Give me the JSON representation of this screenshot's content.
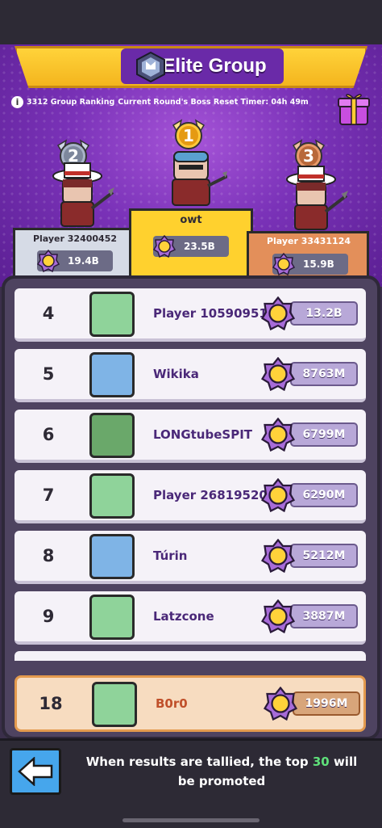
{
  "header": {
    "title": "Elite Group",
    "group_ranking": "3312 Group Ranking",
    "timer_label": "Current Round's Boss Reset Timer: 04h 49m"
  },
  "podium": [
    {
      "rank": "1",
      "name": "owt",
      "score": "23.5B"
    },
    {
      "rank": "2",
      "name": "Player 32400452",
      "score": "19.4B"
    },
    {
      "rank": "3",
      "name": "Player 33431124",
      "score": "15.9B"
    }
  ],
  "list": [
    {
      "rank": "4",
      "name": "Player 10590951",
      "score": "13.2B",
      "avatar": "cat",
      "tag": "S3"
    },
    {
      "rank": "5",
      "name": "Wikika",
      "score": "8763M",
      "avatar": "fish-wizard",
      "tag": ""
    },
    {
      "rank": "6",
      "name": "LONGtubeSPIT",
      "score": "6799M",
      "avatar": "monster",
      "tag": "S2"
    },
    {
      "rank": "7",
      "name": "Player 26819520",
      "score": "6290M",
      "avatar": "ninja",
      "tag": ""
    },
    {
      "rank": "8",
      "name": "Túrin",
      "score": "5212M",
      "avatar": "pirate",
      "tag": "S3"
    },
    {
      "rank": "9",
      "name": "Latzcone",
      "score": "3887M",
      "avatar": "pirate-green",
      "tag": ""
    }
  ],
  "my_rank": {
    "rank": "18",
    "name": "B0r0",
    "score": "1996M",
    "avatar": "cat",
    "tag": "S3"
  },
  "footer": {
    "text_before": "When results are tallied, the top ",
    "highlight": "30",
    "text_after": " will be promoted"
  },
  "colors": {
    "accent_purple": "#7a32b8",
    "banner_gold": "#ffd33a",
    "highlight_green": "#5fe07a"
  }
}
